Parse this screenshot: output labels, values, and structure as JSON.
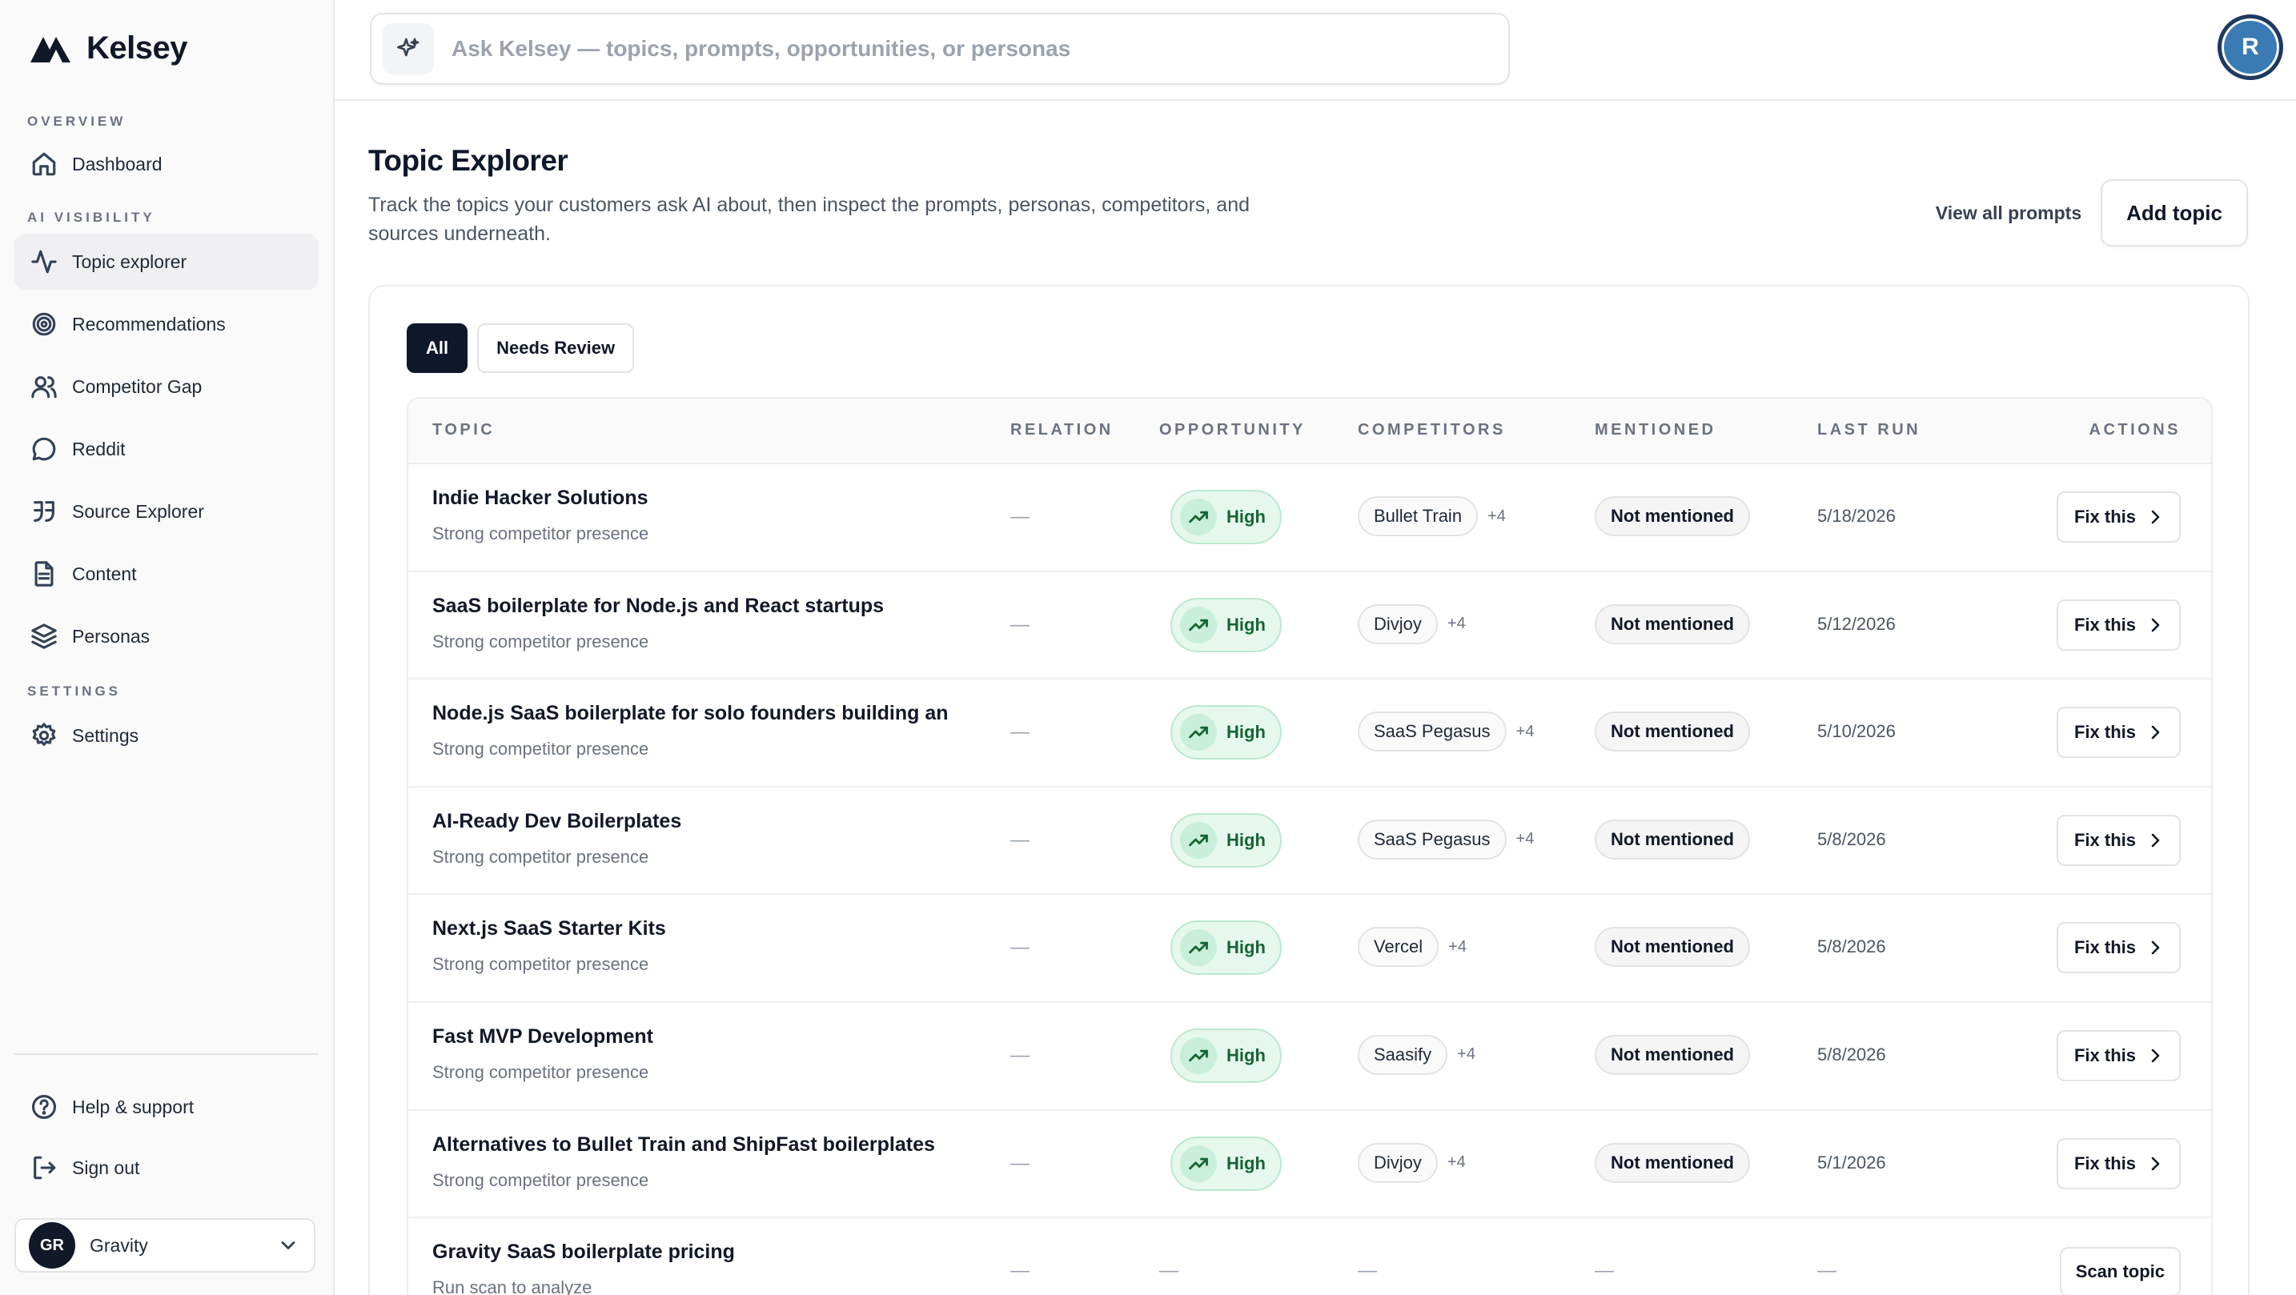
{
  "brand": {
    "name": "Kelsey"
  },
  "sidebar": {
    "sections": [
      {
        "label": "OVERVIEW"
      },
      {
        "label": "AI VISIBILITY"
      },
      {
        "label": "SETTINGS"
      }
    ],
    "items": [
      {
        "label": "Dashboard",
        "icon": "home-icon"
      },
      {
        "label": "Topic explorer",
        "icon": "activity-icon",
        "active": true
      },
      {
        "label": "Recommendations",
        "icon": "target-icon"
      },
      {
        "label": "Competitor Gap",
        "icon": "users-icon"
      },
      {
        "label": "Reddit",
        "icon": "chat-bubble-icon"
      },
      {
        "label": "Source Explorer",
        "icon": "quote-icon"
      },
      {
        "label": "Content",
        "icon": "document-icon"
      },
      {
        "label": "Personas",
        "icon": "layers-icon"
      },
      {
        "label": "Settings",
        "icon": "gear-icon"
      }
    ],
    "bottom": [
      {
        "label": "Help & support",
        "icon": "help-circle-icon"
      },
      {
        "label": "Sign out",
        "icon": "sign-out-icon"
      }
    ],
    "workspace": {
      "initials": "GR",
      "name": "Gravity"
    }
  },
  "search": {
    "placeholder": "Ask Kelsey — topics, prompts, opportunities, or personas"
  },
  "user": {
    "initial": "R"
  },
  "page": {
    "title": "Topic Explorer",
    "subtitle": "Track the topics your customers ask AI about, then inspect the prompts, personas, competitors, and sources underneath.",
    "view_all_label": "View all prompts",
    "add_topic_label": "Add topic"
  },
  "filters": [
    {
      "label": "All",
      "active": true
    },
    {
      "label": "Needs Review",
      "active": false
    }
  ],
  "table": {
    "headers": {
      "topic": "TOPIC",
      "relation": "RELATION",
      "opportunity": "OPPORTUNITY",
      "competitors": "COMPETITORS",
      "mentioned": "MENTIONED",
      "last_run": "LAST RUN",
      "actions": "ACTIONS"
    },
    "rows": [
      {
        "topic": "Indie Hacker Solutions",
        "sub": "Strong competitor presence",
        "relation": "—",
        "opportunity": "High",
        "competitor": "Bullet Train",
        "more": "+4",
        "mentioned": "Not mentioned",
        "last_run": "5/18/2026",
        "action": "Fix this"
      },
      {
        "topic": "SaaS boilerplate for Node.js and React startups",
        "sub": "Strong competitor presence",
        "relation": "—",
        "opportunity": "High",
        "competitor": "Divjoy",
        "more": "+4",
        "mentioned": "Not mentioned",
        "last_run": "5/12/2026",
        "action": "Fix this"
      },
      {
        "topic": "Node.js SaaS boilerplate for solo founders building an",
        "sub": "Strong competitor presence",
        "relation": "—",
        "opportunity": "High",
        "competitor": "SaaS Pegasus",
        "more": "+4",
        "mentioned": "Not mentioned",
        "last_run": "5/10/2026",
        "action": "Fix this"
      },
      {
        "topic": "AI-Ready Dev Boilerplates",
        "sub": "Strong competitor presence",
        "relation": "—",
        "opportunity": "High",
        "competitor": "SaaS Pegasus",
        "more": "+4",
        "mentioned": "Not mentioned",
        "last_run": "5/8/2026",
        "action": "Fix this"
      },
      {
        "topic": "Next.js SaaS Starter Kits",
        "sub": "Strong competitor presence",
        "relation": "—",
        "opportunity": "High",
        "competitor": "Vercel",
        "more": "+4",
        "mentioned": "Not mentioned",
        "last_run": "5/8/2026",
        "action": "Fix this"
      },
      {
        "topic": "Fast MVP Development",
        "sub": "Strong competitor presence",
        "relation": "—",
        "opportunity": "High",
        "competitor": "Saasify",
        "more": "+4",
        "mentioned": "Not mentioned",
        "last_run": "5/8/2026",
        "action": "Fix this"
      },
      {
        "topic": "Alternatives to Bullet Train and ShipFast boilerplates",
        "sub": "Strong competitor presence",
        "relation": "—",
        "opportunity": "High",
        "competitor": "Divjoy",
        "more": "+4",
        "mentioned": "Not mentioned",
        "last_run": "5/1/2026",
        "action": "Fix this"
      }
    ],
    "pending_row": {
      "topic": "Gravity SaaS boilerplate pricing",
      "sub": "Run scan to analyze",
      "relation": "—",
      "opportunity": "—",
      "competitors": "—",
      "mentioned": "—",
      "last_run": "—",
      "action": "Scan topic"
    }
  }
}
